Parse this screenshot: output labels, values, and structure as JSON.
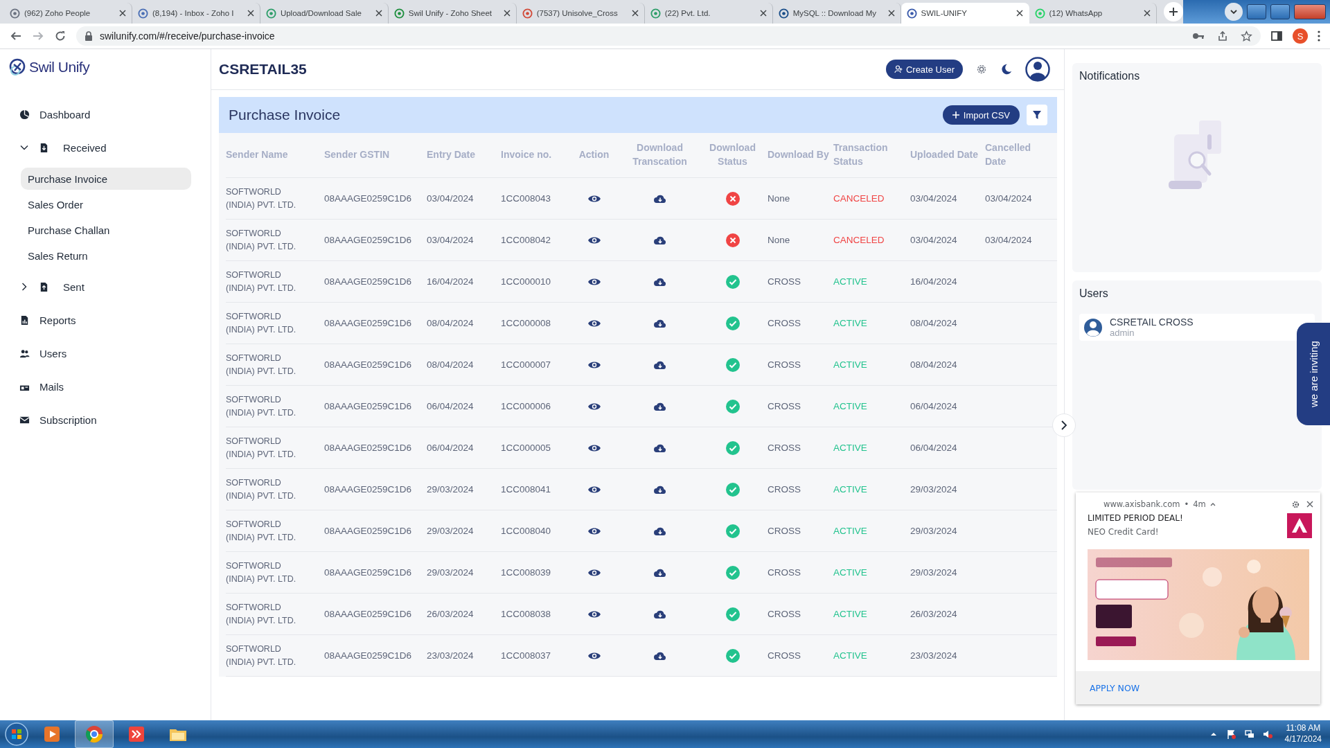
{
  "browser": {
    "tabs": [
      {
        "title": "(962) Zoho People",
        "selected": false
      },
      {
        "title": "(8,194) - Inbox - Zoho I",
        "selected": false
      },
      {
        "title": "Upload/Download Sale",
        "selected": false
      },
      {
        "title": "Swil Unify - Zoho Sheet",
        "selected": false
      },
      {
        "title": "(7537) Unisolve_Cross",
        "selected": false
      },
      {
        "title": "(22) Pvt. Ltd.",
        "selected": false
      },
      {
        "title": "MySQL :: Download My",
        "selected": false
      },
      {
        "title": "SWIL-UNIFY",
        "selected": true
      },
      {
        "title": "(12) WhatsApp",
        "selected": false
      }
    ],
    "url": "swilunify.com/#/receive/purchase-invoice",
    "profile_initial": "S"
  },
  "app": {
    "logo": "Swil Unify",
    "org": "CSRETAIL35",
    "create_user": "Create User"
  },
  "sidebar": {
    "items": [
      {
        "label": "Dashboard",
        "selected": false
      },
      {
        "label": "Received",
        "selected": false,
        "expanded": true,
        "children": [
          {
            "label": "Purchase Invoice",
            "selected": true
          },
          {
            "label": "Sales Order",
            "selected": false
          },
          {
            "label": "Purchase Challan",
            "selected": false
          },
          {
            "label": "Sales Return",
            "selected": false
          }
        ]
      },
      {
        "label": "Sent",
        "selected": false,
        "expanded": false
      },
      {
        "label": "Reports",
        "selected": false
      },
      {
        "label": "Users",
        "selected": false
      },
      {
        "label": "Mails",
        "selected": false
      },
      {
        "label": "Subscription",
        "selected": false
      }
    ]
  },
  "page": {
    "title": "Purchase Invoice",
    "import_button": "Import CSV",
    "columns": [
      "Sender Name",
      "Sender GSTIN",
      "Entry Date",
      "Invoice no.",
      "Action",
      "Download Transcation",
      "Download Status",
      "Download By",
      "Transaction Status",
      "Uploaded Date",
      "Cancelled Date"
    ],
    "rows": [
      {
        "sender_name": "SOFTWORLD (INDIA) PVT. LTD.",
        "gstin": "08AAAGE0259C1D6",
        "entry_date": "03/04/2024",
        "invoice_no": "1CC008043",
        "download_success": false,
        "download_by": "None",
        "transaction_status": "CANCELED",
        "color": "#f04444",
        "uploaded_date": "03/04/2024",
        "cancelled_date": "03/04/2024"
      },
      {
        "sender_name": "SOFTWORLD (INDIA) PVT. LTD.",
        "gstin": "08AAAGE0259C1D6",
        "entry_date": "03/04/2024",
        "invoice_no": "1CC008042",
        "download_success": false,
        "download_by": "None",
        "transaction_status": "CANCELED",
        "color": "#f04444",
        "uploaded_date": "03/04/2024",
        "cancelled_date": "03/04/2024"
      },
      {
        "sender_name": "SOFTWORLD (INDIA) PVT. LTD.",
        "gstin": "08AAAGE0259C1D6",
        "entry_date": "16/04/2024",
        "invoice_no": "1CC000010",
        "download_success": true,
        "download_by": "CROSS",
        "transaction_status": "ACTIVE",
        "color": "#22c38e",
        "uploaded_date": "16/04/2024"
      },
      {
        "sender_name": "SOFTWORLD (INDIA) PVT. LTD.",
        "gstin": "08AAAGE0259C1D6",
        "entry_date": "08/04/2024",
        "invoice_no": "1CC000008",
        "download_success": true,
        "download_by": "CROSS",
        "transaction_status": "ACTIVE",
        "color": "#22c38e",
        "uploaded_date": "08/04/2024"
      },
      {
        "sender_name": "SOFTWORLD (INDIA) PVT. LTD.",
        "gstin": "08AAAGE0259C1D6",
        "entry_date": "08/04/2024",
        "invoice_no": "1CC000007",
        "download_success": true,
        "download_by": "CROSS",
        "transaction_status": "ACTIVE",
        "color": "#22c38e",
        "uploaded_date": "08/04/2024"
      },
      {
        "sender_name": "SOFTWORLD (INDIA) PVT. LTD.",
        "gstin": "08AAAGE0259C1D6",
        "entry_date": "06/04/2024",
        "invoice_no": "1CC000006",
        "download_success": true,
        "download_by": "CROSS",
        "transaction_status": "ACTIVE",
        "color": "#22c38e",
        "uploaded_date": "06/04/2024"
      },
      {
        "sender_name": "SOFTWORLD (INDIA) PVT. LTD.",
        "gstin": "08AAAGE0259C1D6",
        "entry_date": "06/04/2024",
        "invoice_no": "1CC000005",
        "download_success": true,
        "download_by": "CROSS",
        "transaction_status": "ACTIVE",
        "color": "#22c38e",
        "uploaded_date": "06/04/2024"
      },
      {
        "sender_name": "SOFTWORLD (INDIA) PVT. LTD.",
        "gstin": "08AAAGE0259C1D6",
        "entry_date": "29/03/2024",
        "invoice_no": "1CC008041",
        "download_success": true,
        "download_by": "CROSS",
        "transaction_status": "ACTIVE",
        "color": "#22c38e",
        "uploaded_date": "29/03/2024"
      },
      {
        "sender_name": "SOFTWORLD (INDIA) PVT. LTD.",
        "gstin": "08AAAGE0259C1D6",
        "entry_date": "29/03/2024",
        "invoice_no": "1CC008040",
        "download_success": true,
        "download_by": "CROSS",
        "transaction_status": "ACTIVE",
        "color": "#22c38e",
        "uploaded_date": "29/03/2024"
      },
      {
        "sender_name": "SOFTWORLD (INDIA) PVT. LTD.",
        "gstin": "08AAAGE0259C1D6",
        "entry_date": "29/03/2024",
        "invoice_no": "1CC008039",
        "download_success": true,
        "download_by": "CROSS",
        "transaction_status": "ACTIVE",
        "color": "#22c38e",
        "uploaded_date": "29/03/2024"
      },
      {
        "sender_name": "SOFTWORLD (INDIA) PVT. LTD.",
        "gstin": "08AAAGE0259C1D6",
        "entry_date": "26/03/2024",
        "invoice_no": "1CC008038",
        "download_success": true,
        "download_by": "CROSS",
        "transaction_status": "ACTIVE",
        "color": "#22c38e",
        "uploaded_date": "26/03/2024"
      },
      {
        "sender_name": "SOFTWORLD (INDIA) PVT. LTD.",
        "gstin": "08AAAGE0259C1D6",
        "entry_date": "23/03/2024",
        "invoice_no": "1CC008037",
        "download_success": true,
        "download_by": "CROSS",
        "transaction_status": "ACTIVE",
        "color": "#22c38e",
        "uploaded_date": "23/03/2024"
      }
    ]
  },
  "right_panel": {
    "notifications_title": "Notifications",
    "users_title": "Users",
    "users": [
      {
        "name": "CSRETAIL CROSS",
        "role": "admin"
      }
    ],
    "invite_tab": "we are inviting"
  },
  "ad_notification": {
    "source": "www.axisbank.com",
    "dot": "•",
    "age": "4m",
    "title": "LIMITED PERIOD DEAL!",
    "body": "NEO Credit Card!",
    "action": "APPLY NOW"
  },
  "taskbar": {
    "time": "11:08 AM",
    "date": "4/17/2024"
  }
}
